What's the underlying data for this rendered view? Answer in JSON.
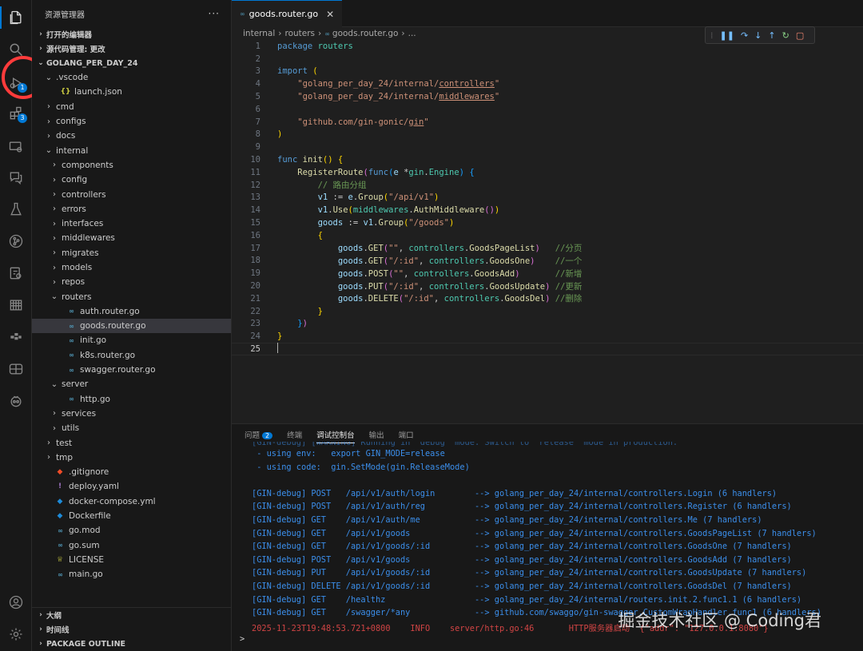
{
  "explorer": {
    "title": "资源管理器",
    "more": "···",
    "sections": {
      "open_editors": "打开的编辑器",
      "scm": "源代码管理: 更改",
      "project": "GOLANG_PER_DAY_24"
    },
    "tree": [
      {
        "label": ".vscode",
        "type": "folder-open",
        "depth": 1
      },
      {
        "label": "launch.json",
        "type": "json",
        "depth": 2
      },
      {
        "label": "cmd",
        "type": "folder",
        "depth": 1
      },
      {
        "label": "configs",
        "type": "folder",
        "depth": 1
      },
      {
        "label": "docs",
        "type": "folder",
        "depth": 1
      },
      {
        "label": "internal",
        "type": "folder-open",
        "depth": 1
      },
      {
        "label": "components",
        "type": "folder",
        "depth": 2
      },
      {
        "label": "config",
        "type": "folder",
        "depth": 2
      },
      {
        "label": "controllers",
        "type": "folder",
        "depth": 2
      },
      {
        "label": "errors",
        "type": "folder",
        "depth": 2
      },
      {
        "label": "interfaces",
        "type": "folder",
        "depth": 2
      },
      {
        "label": "middlewares",
        "type": "folder",
        "depth": 2
      },
      {
        "label": "migrates",
        "type": "folder",
        "depth": 2
      },
      {
        "label": "models",
        "type": "folder",
        "depth": 2
      },
      {
        "label": "repos",
        "type": "folder",
        "depth": 2
      },
      {
        "label": "routers",
        "type": "folder-open",
        "depth": 2
      },
      {
        "label": "auth.router.go",
        "type": "go",
        "depth": 3
      },
      {
        "label": "goods.router.go",
        "type": "go",
        "depth": 3,
        "selected": true
      },
      {
        "label": "init.go",
        "type": "go",
        "depth": 3
      },
      {
        "label": "k8s.router.go",
        "type": "go",
        "depth": 3
      },
      {
        "label": "swagger.router.go",
        "type": "go",
        "depth": 3
      },
      {
        "label": "server",
        "type": "folder-open",
        "depth": 2
      },
      {
        "label": "http.go",
        "type": "go",
        "depth": 3
      },
      {
        "label": "services",
        "type": "folder",
        "depth": 2
      },
      {
        "label": "utils",
        "type": "folder",
        "depth": 2
      },
      {
        "label": "test",
        "type": "folder",
        "depth": 1
      },
      {
        "label": "tmp",
        "type": "folder",
        "depth": 1
      },
      {
        "label": ".gitignore",
        "type": "git",
        "depth": 1
      },
      {
        "label": "deploy.yaml",
        "type": "yaml",
        "depth": 1
      },
      {
        "label": "docker-compose.yml",
        "type": "docker",
        "depth": 1
      },
      {
        "label": "Dockerfile",
        "type": "docker",
        "depth": 1
      },
      {
        "label": "go.mod",
        "type": "go",
        "depth": 1
      },
      {
        "label": "go.sum",
        "type": "go",
        "depth": 1
      },
      {
        "label": "LICENSE",
        "type": "license",
        "depth": 1
      },
      {
        "label": "main.go",
        "type": "go",
        "depth": 1
      }
    ],
    "bottom_sections": [
      "大纲",
      "时间线",
      "PACKAGE OUTLINE"
    ]
  },
  "activity": {
    "debug_badge": "1",
    "extensions_badge": "3"
  },
  "editor": {
    "tab_label": "goods.router.go",
    "tab_icon": "∞",
    "breadcrumb": [
      "internal",
      "routers",
      "goods.router.go",
      "..."
    ]
  },
  "code_lines": [
    [
      {
        "c": "k",
        "t": "package"
      },
      {
        "t": " "
      },
      {
        "c": "t",
        "t": "routers"
      }
    ],
    [],
    [
      {
        "c": "k",
        "t": "import"
      },
      {
        "t": " "
      },
      {
        "c": "b1",
        "t": "("
      }
    ],
    [
      {
        "t": "    "
      },
      {
        "c": "s",
        "t": "\"golang_per_day_24/internal/"
      },
      {
        "c": "s u",
        "t": "controllers"
      },
      {
        "c": "s",
        "t": "\""
      }
    ],
    [
      {
        "t": "    "
      },
      {
        "c": "s",
        "t": "\"golang_per_day_24/internal/"
      },
      {
        "c": "s u",
        "t": "middlewares"
      },
      {
        "c": "s",
        "t": "\""
      }
    ],
    [],
    [
      {
        "t": "    "
      },
      {
        "c": "s",
        "t": "\"github.com/gin-gonic/"
      },
      {
        "c": "s u",
        "t": "gin"
      },
      {
        "c": "s",
        "t": "\""
      }
    ],
    [
      {
        "c": "b1",
        "t": ")"
      }
    ],
    [],
    [
      {
        "c": "k",
        "t": "func"
      },
      {
        "t": " "
      },
      {
        "c": "f",
        "t": "init"
      },
      {
        "c": "b1",
        "t": "()"
      },
      {
        "t": " "
      },
      {
        "c": "b1",
        "t": "{"
      }
    ],
    [
      {
        "t": "    "
      },
      {
        "c": "f",
        "t": "RegisterRoute"
      },
      {
        "c": "b2",
        "t": "("
      },
      {
        "c": "k",
        "t": "func"
      },
      {
        "c": "b3",
        "t": "("
      },
      {
        "c": "v",
        "t": "e"
      },
      {
        "t": " *"
      },
      {
        "c": "t",
        "t": "gin"
      },
      {
        "t": "."
      },
      {
        "c": "t",
        "t": "Engine"
      },
      {
        "c": "b3",
        "t": ")"
      },
      {
        "t": " "
      },
      {
        "c": "b3",
        "t": "{"
      }
    ],
    [
      {
        "t": "        "
      },
      {
        "c": "c",
        "t": "// 路由分组"
      }
    ],
    [
      {
        "t": "        "
      },
      {
        "c": "v",
        "t": "v1"
      },
      {
        "t": " := "
      },
      {
        "c": "v",
        "t": "e"
      },
      {
        "t": "."
      },
      {
        "c": "f",
        "t": "Group"
      },
      {
        "c": "b1",
        "t": "("
      },
      {
        "c": "s",
        "t": "\"/api/v1\""
      },
      {
        "c": "b1",
        "t": ")"
      }
    ],
    [
      {
        "t": "        "
      },
      {
        "c": "v",
        "t": "v1"
      },
      {
        "t": "."
      },
      {
        "c": "f",
        "t": "Use"
      },
      {
        "c": "b1",
        "t": "("
      },
      {
        "c": "t",
        "t": "middlewares"
      },
      {
        "t": "."
      },
      {
        "c": "f",
        "t": "AuthMiddleware"
      },
      {
        "c": "b2",
        "t": "()"
      },
      {
        "c": "b1",
        "t": ")"
      }
    ],
    [
      {
        "t": "        "
      },
      {
        "c": "v",
        "t": "goods"
      },
      {
        "t": " := "
      },
      {
        "c": "v",
        "t": "v1"
      },
      {
        "t": "."
      },
      {
        "c": "f",
        "t": "Group"
      },
      {
        "c": "b1",
        "t": "("
      },
      {
        "c": "s",
        "t": "\"/goods\""
      },
      {
        "c": "b1",
        "t": ")"
      }
    ],
    [
      {
        "t": "        "
      },
      {
        "c": "b1",
        "t": "{"
      }
    ],
    [
      {
        "t": "            "
      },
      {
        "c": "v",
        "t": "goods"
      },
      {
        "t": "."
      },
      {
        "c": "f",
        "t": "GET"
      },
      {
        "c": "b2",
        "t": "("
      },
      {
        "c": "s",
        "t": "\"\""
      },
      {
        "t": ", "
      },
      {
        "c": "t",
        "t": "controllers"
      },
      {
        "t": "."
      },
      {
        "c": "f",
        "t": "GoodsPageList"
      },
      {
        "c": "b2",
        "t": ")"
      },
      {
        "t": "   "
      },
      {
        "c": "c",
        "t": "//分页"
      }
    ],
    [
      {
        "t": "            "
      },
      {
        "c": "v",
        "t": "goods"
      },
      {
        "t": "."
      },
      {
        "c": "f",
        "t": "GET"
      },
      {
        "c": "b2",
        "t": "("
      },
      {
        "c": "s",
        "t": "\"/:id\""
      },
      {
        "t": ", "
      },
      {
        "c": "t",
        "t": "controllers"
      },
      {
        "t": "."
      },
      {
        "c": "f",
        "t": "GoodsOne"
      },
      {
        "c": "b2",
        "t": ")"
      },
      {
        "t": "    "
      },
      {
        "c": "c",
        "t": "//一个"
      }
    ],
    [
      {
        "t": "            "
      },
      {
        "c": "v",
        "t": "goods"
      },
      {
        "t": "."
      },
      {
        "c": "f",
        "t": "POST"
      },
      {
        "c": "b2",
        "t": "("
      },
      {
        "c": "s",
        "t": "\"\""
      },
      {
        "t": ", "
      },
      {
        "c": "t",
        "t": "controllers"
      },
      {
        "t": "."
      },
      {
        "c": "f",
        "t": "GoodsAdd"
      },
      {
        "c": "b2",
        "t": ")"
      },
      {
        "t": "       "
      },
      {
        "c": "c",
        "t": "//新增"
      }
    ],
    [
      {
        "t": "            "
      },
      {
        "c": "v",
        "t": "goods"
      },
      {
        "t": "."
      },
      {
        "c": "f",
        "t": "PUT"
      },
      {
        "c": "b2",
        "t": "("
      },
      {
        "c": "s",
        "t": "\"/:id\""
      },
      {
        "t": ", "
      },
      {
        "c": "t",
        "t": "controllers"
      },
      {
        "t": "."
      },
      {
        "c": "f",
        "t": "GoodsUpdate"
      },
      {
        "c": "b2",
        "t": ")"
      },
      {
        "t": " "
      },
      {
        "c": "c",
        "t": "//更新"
      }
    ],
    [
      {
        "t": "            "
      },
      {
        "c": "v",
        "t": "goods"
      },
      {
        "t": "."
      },
      {
        "c": "f",
        "t": "DELETE"
      },
      {
        "c": "b2",
        "t": "("
      },
      {
        "c": "s",
        "t": "\"/:id\""
      },
      {
        "t": ", "
      },
      {
        "c": "t",
        "t": "controllers"
      },
      {
        "t": "."
      },
      {
        "c": "f",
        "t": "GoodsDel"
      },
      {
        "c": "b2",
        "t": ")"
      },
      {
        "t": " "
      },
      {
        "c": "c",
        "t": "//删除"
      }
    ],
    [
      {
        "t": "        "
      },
      {
        "c": "b1",
        "t": "}"
      }
    ],
    [
      {
        "t": "    "
      },
      {
        "c": "b3",
        "t": "}"
      },
      {
        "c": "b2",
        "t": ")"
      }
    ],
    [
      {
        "c": "b1",
        "t": "}"
      }
    ],
    []
  ],
  "panel": {
    "tabs": [
      "问题",
      "终端",
      "调试控制台",
      "输出",
      "端口"
    ],
    "problems_count": "2",
    "active_tab": "调试控制台",
    "lines": [
      "[GIN-debug] [WARNING] Running in \"debug\" mode. Switch to \"release\" mode in production.",
      " - using env:   export GIN_MODE=release",
      " - using code:  gin.SetMode(gin.ReleaseMode)",
      "",
      "[GIN-debug] POST   /api/v1/auth/login        --> golang_per_day_24/internal/controllers.Login (6 handlers)",
      "[GIN-debug] POST   /api/v1/auth/reg          --> golang_per_day_24/internal/controllers.Register (6 handlers)",
      "[GIN-debug] GET    /api/v1/auth/me           --> golang_per_day_24/internal/controllers.Me (7 handlers)",
      "[GIN-debug] GET    /api/v1/goods             --> golang_per_day_24/internal/controllers.GoodsPageList (7 handlers)",
      "[GIN-debug] GET    /api/v1/goods/:id         --> golang_per_day_24/internal/controllers.GoodsOne (7 handlers)",
      "[GIN-debug] POST   /api/v1/goods             --> golang_per_day_24/internal/controllers.GoodsAdd (7 handlers)",
      "[GIN-debug] PUT    /api/v1/goods/:id         --> golang_per_day_24/internal/controllers.GoodsUpdate (7 handlers)",
      "[GIN-debug] DELETE /api/v1/goods/:id         --> golang_per_day_24/internal/controllers.GoodsDel (7 handlers)",
      "[GIN-debug] GET    /healthz                  --> golang_per_day_24/internal/routers.init.2.func1.1 (6 handlers)",
      "[GIN-debug] GET    /swagger/*any             --> github.com/swaggo/gin-swagger.CustomWrapHandler.func1 (6 handlers)",
      "2025-11-23T19:48:53.721+0800    INFO    server/http.go:46       HTTP服务器启动  {\"addr\": \"127.0.0.1:8080\"}"
    ],
    "prompt": ">"
  },
  "watermark": "掘金技术社区 @ Coding君",
  "colors": {
    "accent": "#0078d4",
    "editor_bg": "#1f1f1f",
    "sidebar_bg": "#181818",
    "console_blue": "#3b8eea",
    "annotation_red": "#ff3b3b"
  }
}
